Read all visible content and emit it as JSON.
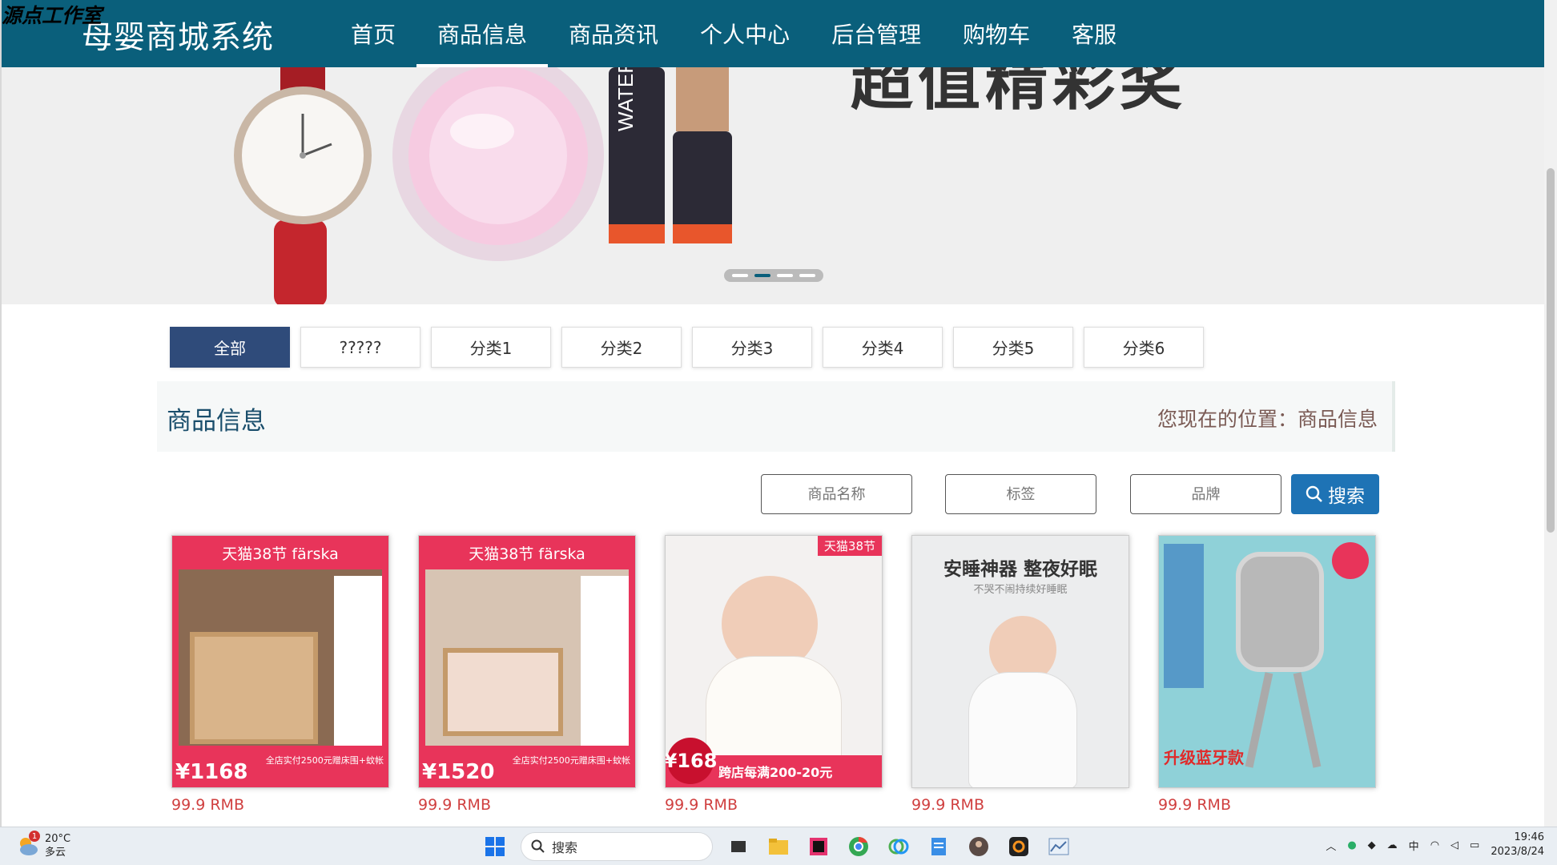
{
  "watermark": "源点工作室",
  "nav": {
    "brand": "母婴商城系统",
    "items": [
      "首页",
      "商品信息",
      "商品资讯",
      "个人中心",
      "后台管理",
      "购物车",
      "客服"
    ],
    "active_index": 1
  },
  "banner": {
    "text": "超值精彩奖",
    "slide_count": 4,
    "active_slide": 1
  },
  "categories": [
    "全部",
    "?????",
    "分类1",
    "分类2",
    "分类3",
    "分类4",
    "分类5",
    "分类6"
  ],
  "section": {
    "title": "商品信息",
    "location_label": "您现在的位置：商品信息"
  },
  "search": {
    "name_placeholder": "商品名称",
    "tag_placeholder": "标签",
    "brand_placeholder": "品牌",
    "button_label": "搜索"
  },
  "products": [
    {
      "image_title": "天猫38节 färska",
      "image_price": "¥1168",
      "image_promo": "全店实付2500元赠床围+蚊帐",
      "price": "99.9 RMB"
    },
    {
      "image_title": "天猫38节 färska",
      "image_price": "¥1520",
      "image_promo": "全店实付2500元赠床围+蚊帐",
      "price": "99.9 RMB"
    },
    {
      "image_title": "天猫38节",
      "image_price": "¥168",
      "image_promo": "跨店每满200-20元",
      "price": "99.9 RMB"
    },
    {
      "image_title": "安睡神器 整夜好眠",
      "image_price": "",
      "image_promo": "不哭不闹持续好睡眠",
      "price": "99.9 RMB"
    },
    {
      "image_title": "升级蓝牙款",
      "image_price": "",
      "image_promo": "",
      "price": "99.9 RMB"
    }
  ],
  "taskbar": {
    "weather_temp": "20°C",
    "weather_desc": "多云",
    "weather_badge": "1",
    "search_label": "搜索",
    "time": "19:46",
    "date": "2023/8/24",
    "ime": "中"
  },
  "colors": {
    "nav_bg": "#0a5f7b",
    "active_category": "#2f4b7a",
    "search_button": "#1e73b5",
    "price": "#d04040"
  }
}
